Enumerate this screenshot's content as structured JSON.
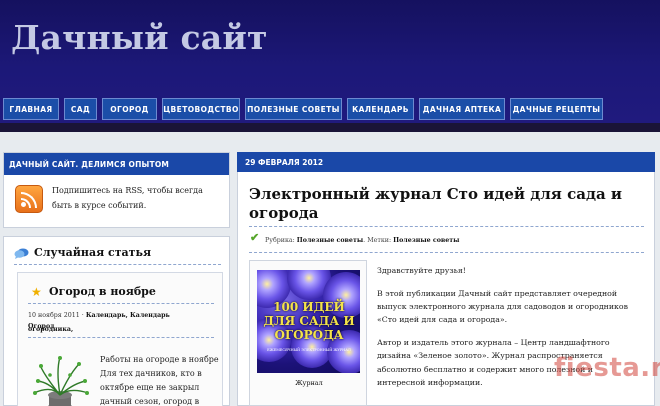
{
  "site": {
    "title": "Дачный сайт"
  },
  "nav": {
    "items": [
      {
        "label": "Главная"
      },
      {
        "label": "Сад"
      },
      {
        "label": "Огород"
      },
      {
        "label": "Цветоводство"
      },
      {
        "label": "Полезные советы"
      },
      {
        "label": "Календарь"
      },
      {
        "label": "Дачная аптека"
      },
      {
        "label": "Дачные рецепты"
      }
    ],
    "active_color": "#1b4ea8"
  },
  "sidebar": {
    "rss_widget": {
      "title": "Дачный сайт. Делимся опытом",
      "text": "Подпишитесь на RSS, чтобы всегда быть в курсе событий.",
      "icon": "rss-icon"
    },
    "random_widget": {
      "title": "Случайная статья",
      "icon": "speech-bubble-icon",
      "article": {
        "title": "Огород в ноябре",
        "date": "10 ноября 2011",
        "categories": "Календарь, Календарь огородника,",
        "categories_cont": "Огород",
        "excerpt": "Работы на огороде в ноябре Для тех дачников, кто в октябре еще не закрыл дачный сезон, огород в"
      }
    }
  },
  "post": {
    "date": "29 февраля 2012",
    "title": "Электронный журнал Сто идей для сада и огорода",
    "meta_rubric_label": "Рубрика:",
    "meta_rubric": "Полезные советы",
    "meta_tags_label": "Метки:",
    "meta_tags": "Полезные советы",
    "journal": {
      "cover_title": "100 ИДЕЙ ДЛЯ САДА И ОГОРОДА",
      "cover_sub": "ЕЖЕМЕСЯЧНЫЙ ЭЛЕКТРОННЫЙ ЖУРНАЛ",
      "caption": "Журнал"
    },
    "paragraphs": [
      "Здравствуйте друзья!",
      "В этой публикации Дачный сайт представляет очередной выпуск электронного журнала для садоводов и огородников «Сто идей для сада и огорода».",
      "Автор и издатель этого журнала – Центр ландшафтного дизайна «Зеленое золото». Журнал распространяется абсолютно бесплатно и содержит много полезной и интересной информации."
    ]
  },
  "watermark": "fiesta.ru",
  "colors": {
    "header_bg": "#1c1878",
    "title_text": "#c4c9e4",
    "bar_blue": "#1a48a8",
    "page_bg": "#e7ebef"
  }
}
